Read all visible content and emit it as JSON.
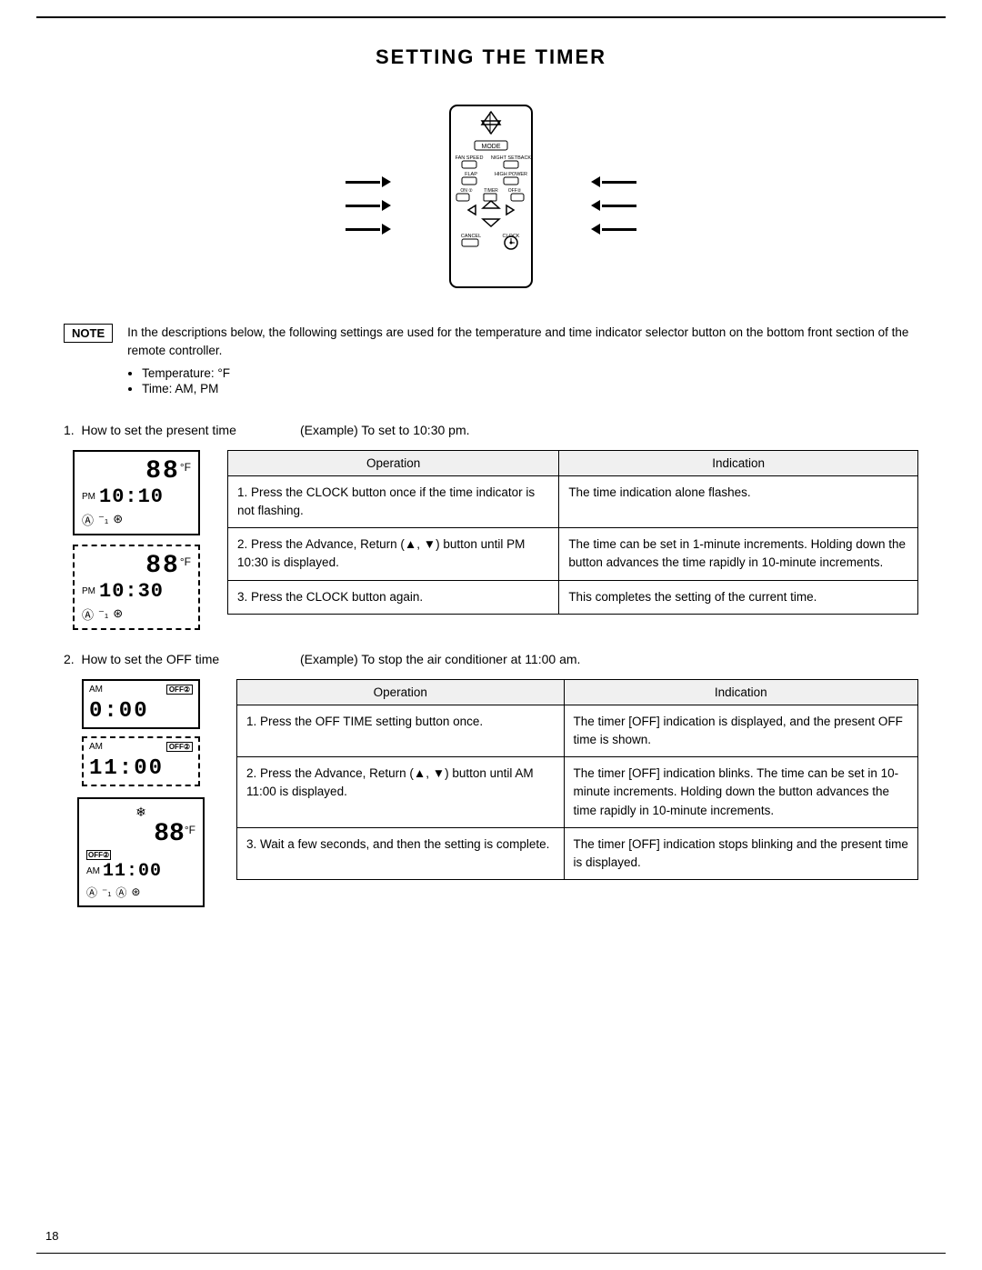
{
  "page": {
    "title": "SETTING THE TIMER",
    "number": "18"
  },
  "note": {
    "label": "NOTE",
    "text": "In the descriptions below, the following settings are used for the temperature and time indicator selector button on the bottom front section of the remote controller.",
    "bullets": [
      "Temperature: °F",
      "Time: AM, PM"
    ]
  },
  "section1": {
    "number": "1.",
    "label": "How to set the present time",
    "example": "(Example) To set to 10:30 pm.",
    "col_headers": [
      "Operation",
      "Indication"
    ],
    "rows": [
      {
        "operation": "1.  Press the CLOCK button once if the time indicator is not flashing.",
        "indication": "The time indication alone flashes."
      },
      {
        "operation": "2.  Press the Advance, Return (▲, ▼) button until PM 10:30 is displayed.",
        "indication": "The time can be set in 1-minute increments. Holding down the button advances the time rapidly in 10-minute increments."
      },
      {
        "operation": "3.  Press the CLOCK button again.",
        "indication": "This completes the setting of the current time."
      }
    ]
  },
  "section2": {
    "number": "2.",
    "label": "How to set the OFF time",
    "example": "(Example) To stop the air conditioner at 11:00 am.",
    "col_headers": [
      "Operation",
      "Indication"
    ],
    "rows": [
      {
        "operation": "1.  Press the OFF TIME setting button once.",
        "indication": "The timer [OFF] indication is displayed, and the present OFF time is shown."
      },
      {
        "operation": "2.  Press the Advance, Return (▲, ▼) button until AM 11:00 is displayed.",
        "indication": "The timer [OFF] indication blinks. The time can be set in 10-minute increments. Holding down the button advances the time rapidly in 10-minute increments."
      },
      {
        "operation": "3.  Wait a few seconds, and then the setting is complete.",
        "indication": "The timer [OFF] indication stops blinking and the present time is displayed."
      }
    ]
  }
}
